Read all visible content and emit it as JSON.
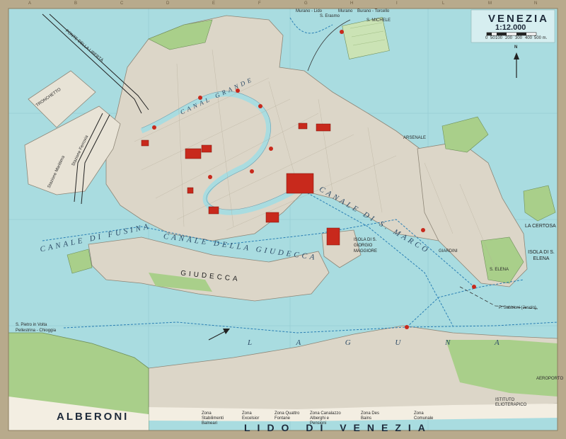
{
  "title": "VENEZIA",
  "scale": "1:12.000",
  "scale_ticks": [
    "0",
    "50",
    "100",
    "200",
    "300",
    "400",
    "500 m."
  ],
  "north_label": "N",
  "edge_letters": [
    "A",
    "B",
    "C",
    "D",
    "E",
    "F",
    "G",
    "H",
    "I",
    "L",
    "M",
    "N"
  ],
  "water_labels": {
    "canal_grande": "CANAL GRANDE",
    "canale_fusina": "CANALE DI FUSINA",
    "canale_giudecca": "CANALE DELLA GIUDECCA",
    "canale_san_marco": "CANALE DI S. MARCO",
    "laguna": "L A G U N A"
  },
  "place_labels": {
    "giudecca": "GIUDECCA",
    "alberoni": "ALBERONI",
    "lido": "LIDO DI VENEZIA",
    "la_certosa": "LA CERTOSA",
    "isola_s_elena": "ISOLA DI S. ELENA",
    "isola_s_giorgio": "ISOLA DI S. GIORGIO MAGGIORE",
    "ponte_liberta": "PONTE DELLA LIBERTÀ",
    "tronchetto": "TRONCHETTO",
    "s_michele": "S. MICHELE",
    "murano_lido": "Murano - Lido",
    "s_erasmo": "S. Erasmo",
    "murano": "Murano",
    "burano_torcello": "Burano - Torcello",
    "s_pietro_volta": "S. Pietro in Volta",
    "pellestrina": "Pellestrina - Chioggia",
    "p_sabbioni": "P. Sabbioni (Jesolo)",
    "aeroporto": "AEROPORTO",
    "istituto": "ISTITUTO ELIOTERAPICO",
    "zona_1": "Zona Stabilimenti Balneari",
    "zona_2": "Zona Excelsior",
    "zona_3": "Zona Quattro Fontane",
    "zona_4": "Zona Canalazzo Alberghi e Pensioni",
    "zona_5": "Zona Des Bains",
    "zona_6": "Zona Comunale",
    "giardini": "GIARDINI",
    "arsenale": "ARSENALE",
    "s_elena": "S. ELENA",
    "ferrovia": "Stazione Ferrovia",
    "marittima": "Stazione Marittima"
  },
  "colors": {
    "water": "#a9dce0",
    "land": "#dcd6c8",
    "park": "#a9cf8a",
    "monument": "#c8291c",
    "border": "#b8aa8c",
    "route": "#2a7fb4"
  },
  "icons": [
    "north-arrow-icon",
    "compass-rose-icon"
  ]
}
